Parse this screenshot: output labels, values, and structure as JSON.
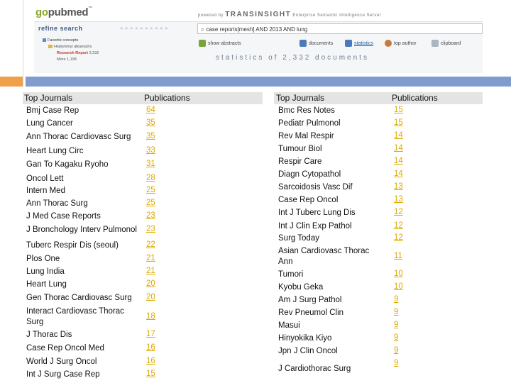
{
  "brand": {
    "logo_go": "go",
    "logo_rest": "pubmed",
    "logo_tm": "™",
    "powered_prefix": "powered by",
    "powered_brand": "TRANSINSIGHT",
    "powered_suffix": "Enterprise Semantic Intelligence Server"
  },
  "refine": {
    "title": "refine search",
    "items": [
      {
        "label": "Favorite concepts",
        "level": 1,
        "icon": "blue-square-icon"
      },
      {
        "label": "Heptylvinyl alkanophs",
        "level": 2,
        "icon": "folder-icon"
      },
      {
        "label": "Research Report",
        "count": "2,332",
        "level": 3,
        "selected": true
      },
      {
        "label": "More",
        "count": "1,198",
        "level": 3
      }
    ]
  },
  "query": {
    "text": "case reports[mesh] AND 2013 AND lung"
  },
  "toolbar": {
    "items": [
      {
        "label": "show abstracts",
        "icon": "abstracts-icon",
        "color": "#7aa33a"
      },
      {
        "label": "documents",
        "icon": "documents-icon",
        "color": "#4a7ab8"
      },
      {
        "label": "statistics",
        "icon": "statistics-icon",
        "color": "#4a7ab8",
        "active": true
      },
      {
        "label": "top author",
        "icon": "author-icon",
        "color": "#c77b3c"
      },
      {
        "label": "clipboard",
        "icon": "clipboard-icon",
        "color": "#aab4c2"
      }
    ]
  },
  "stats_title": "statistics of 2,332 documents",
  "accent": {
    "orange": "#f0a04b",
    "blue": "#7f9ccf",
    "number": "#ddaa00"
  },
  "left": {
    "header": {
      "journal": "Top Journals",
      "count": "Publications"
    },
    "rows": [
      {
        "name": "Bmj Case Rep",
        "count": "64"
      },
      {
        "name": "Lung Cancer",
        "count": "35"
      },
      {
        "name": "Ann Thorac Cardiovasc Surg",
        "count": "35"
      },
      {
        "name": "Heart Lung Circ",
        "count": "33"
      },
      {
        "name": "Gan To Kagaku Ryoho",
        "count": "31"
      },
      {
        "name": "Oncol Lett",
        "count": "28"
      },
      {
        "name": "Intern Med",
        "count": "25"
      },
      {
        "name": "Ann Thorac Surg",
        "count": "25"
      },
      {
        "name": "J Med Case Reports",
        "count": "23"
      },
      {
        "name": "J Bronchology Interv Pulmonol",
        "count": "23"
      },
      {
        "name": "Tuberc Respir Dis (seoul)",
        "count": "22"
      },
      {
        "name": "Plos One",
        "count": "21"
      },
      {
        "name": "Lung India",
        "count": "21"
      },
      {
        "name": "Heart Lung",
        "count": "20"
      },
      {
        "name": "Gen Thorac Cardiovasc Surg",
        "count": "20"
      },
      {
        "name": "Interact Cardiovasc Thorac Surg",
        "count": "18"
      },
      {
        "name": "J Thorac Dis",
        "count": "17"
      },
      {
        "name": "Case Rep Oncol Med",
        "count": "16"
      },
      {
        "name": "World J Surg Oncol",
        "count": "16"
      },
      {
        "name": "Int J Surg Case Rep",
        "count": "15"
      }
    ]
  },
  "right": {
    "header": {
      "journal": "Top Journals",
      "count": "Publications"
    },
    "rows": [
      {
        "name": "Bmc Res Notes",
        "count": "15"
      },
      {
        "name": "Pediatr Pulmonol",
        "count": "15"
      },
      {
        "name": "Rev Mal Respir",
        "count": "14"
      },
      {
        "name": "Tumour Biol",
        "count": "14"
      },
      {
        "name": "Respir Care",
        "count": "14"
      },
      {
        "name": "Diagn Cytopathol",
        "count": "14"
      },
      {
        "name": "Sarcoidosis Vasc Dif",
        "count": "13"
      },
      {
        "name": "Case Rep Oncol",
        "count": "13"
      },
      {
        "name": "Int J Tuberc Lung Dis",
        "count": "12"
      },
      {
        "name": "Int J Clin Exp Pathol",
        "count": "12"
      },
      {
        "name": "Surg Today",
        "count": "12"
      },
      {
        "name": "Asian Cardiovasc Thorac Ann",
        "count": "11"
      },
      {
        "name": "Tumori",
        "count": "10"
      },
      {
        "name": "Kyobu Geka",
        "count": "10"
      },
      {
        "name": "Am J Surg Pathol",
        "count": "9"
      },
      {
        "name": "Rev Pneumol Clin",
        "count": "9"
      },
      {
        "name": "Masui",
        "count": "9"
      },
      {
        "name": "Hinyokika Kiyo",
        "count": "9"
      },
      {
        "name": "Jpn J Clin Oncol",
        "count": "9"
      },
      {
        "name": "J Cardiothorac Surg",
        "count": "9"
      }
    ]
  }
}
